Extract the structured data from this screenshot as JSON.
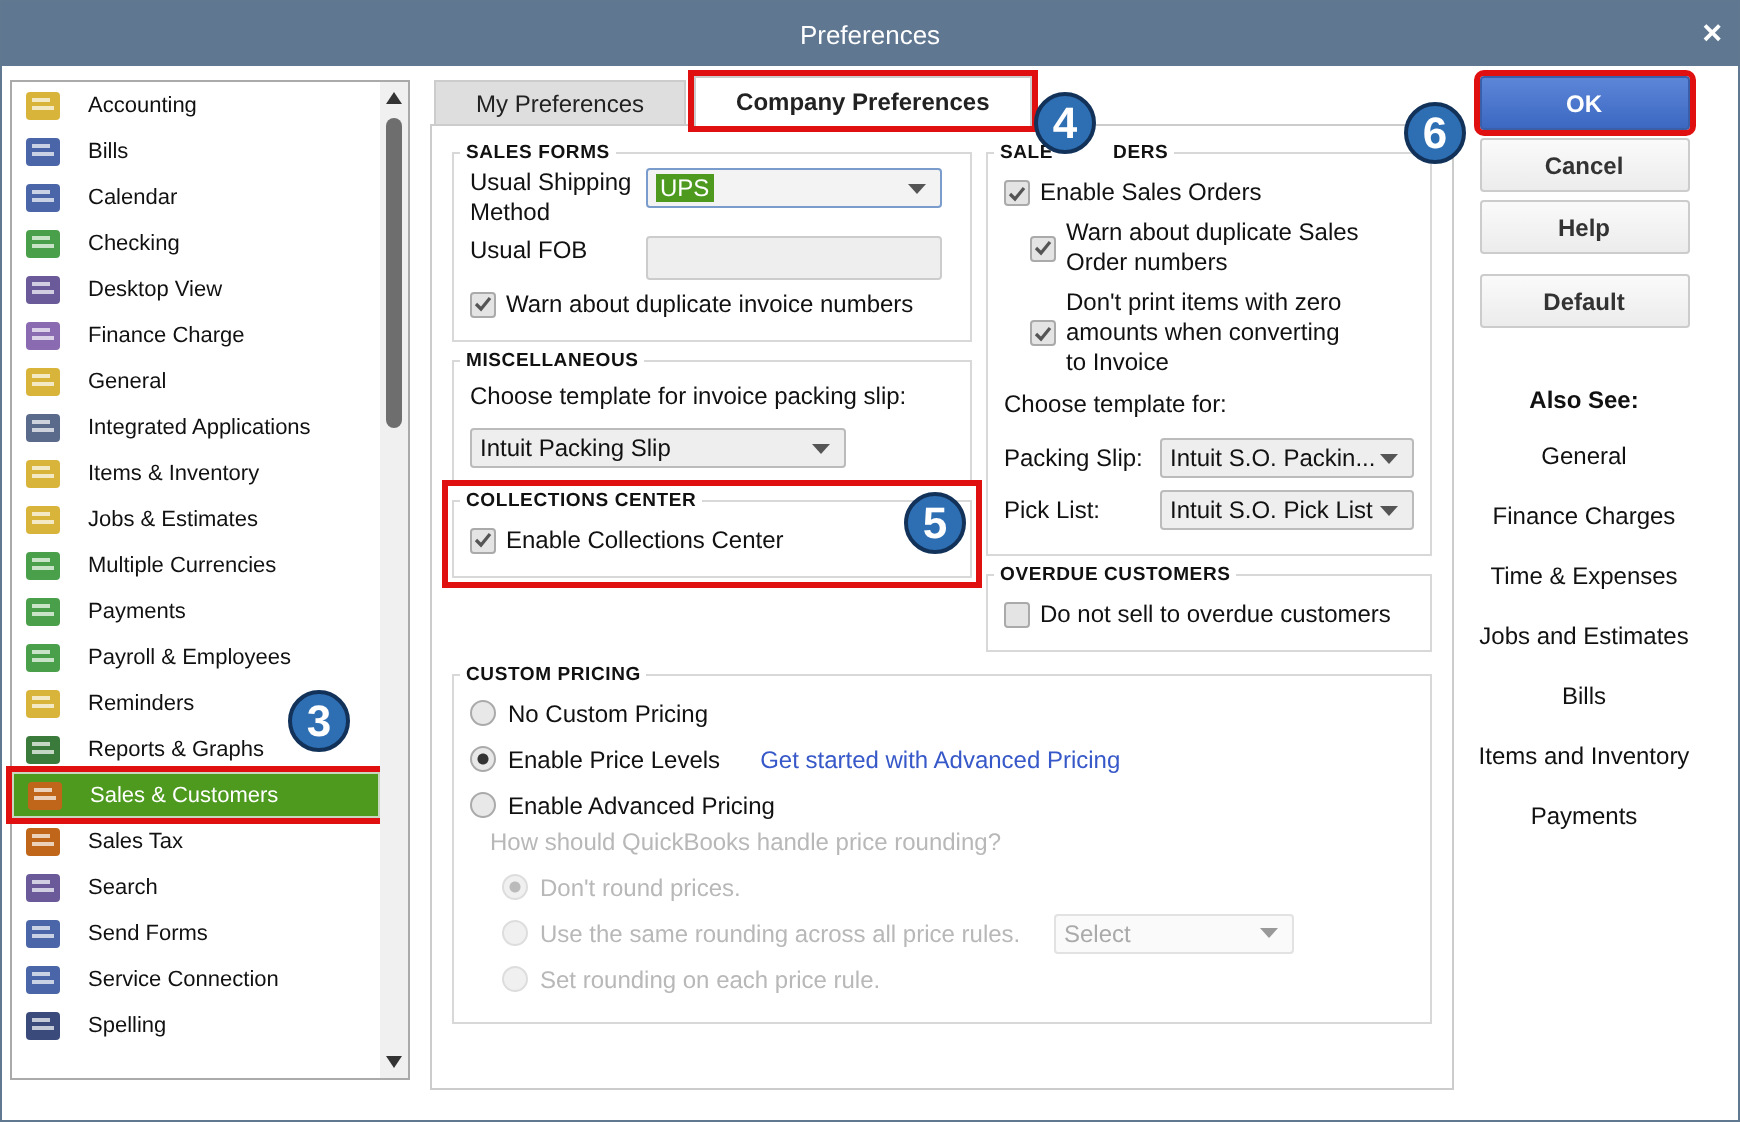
{
  "window": {
    "title": "Preferences",
    "close": "×"
  },
  "categories": [
    {
      "label": "Accounting",
      "selected": false,
      "highlighted": false
    },
    {
      "label": "Bills",
      "selected": false,
      "highlighted": false
    },
    {
      "label": "Calendar",
      "selected": false,
      "highlighted": false
    },
    {
      "label": "Checking",
      "selected": false,
      "highlighted": false
    },
    {
      "label": "Desktop View",
      "selected": false,
      "highlighted": false
    },
    {
      "label": "Finance Charge",
      "selected": false,
      "highlighted": false
    },
    {
      "label": "General",
      "selected": false,
      "highlighted": false
    },
    {
      "label": "Integrated Applications",
      "selected": false,
      "highlighted": false
    },
    {
      "label": "Items & Inventory",
      "selected": false,
      "highlighted": false
    },
    {
      "label": "Jobs & Estimates",
      "selected": false,
      "highlighted": false
    },
    {
      "label": "Multiple Currencies",
      "selected": false,
      "highlighted": false
    },
    {
      "label": "Payments",
      "selected": false,
      "highlighted": false
    },
    {
      "label": "Payroll & Employees",
      "selected": false,
      "highlighted": false
    },
    {
      "label": "Reminders",
      "selected": false,
      "highlighted": false
    },
    {
      "label": "Reports & Graphs",
      "selected": false,
      "highlighted": false
    },
    {
      "label": "Sales & Customers",
      "selected": true,
      "highlighted": true
    },
    {
      "label": "Sales Tax",
      "selected": false,
      "highlighted": false
    },
    {
      "label": "Search",
      "selected": false,
      "highlighted": false
    },
    {
      "label": "Send Forms",
      "selected": false,
      "highlighted": false
    },
    {
      "label": "Service Connection",
      "selected": false,
      "highlighted": false
    },
    {
      "label": "Spelling",
      "selected": false,
      "highlighted": false
    }
  ],
  "tabs": [
    {
      "label": "My Preferences",
      "selected": false,
      "highlighted": false
    },
    {
      "label": "Company Preferences",
      "selected": true,
      "highlighted": true
    }
  ],
  "sales_forms": {
    "title": "SALES FORMS",
    "shipping_label": "Usual Shipping Method",
    "shipping_value": "UPS",
    "fob_label": "Usual FOB",
    "warn": {
      "label": "Warn about duplicate invoice numbers",
      "checked": true
    }
  },
  "miscellaneous": {
    "title": "MISCELLANEOUS",
    "prompt": "Choose template for invoice packing slip:",
    "packing_slip": "Intuit Packing Slip"
  },
  "collections_center": {
    "title": "COLLECTIONS CENTER",
    "highlighted": true,
    "option": {
      "label": "Enable Collections Center",
      "checked": true
    }
  },
  "sales_orders": {
    "title_parts": [
      "SALE",
      "DERS"
    ],
    "options": [
      {
        "label": "Enable Sales Orders",
        "checked": true,
        "indent": false
      },
      {
        "label": "Warn about duplicate Sales Order numbers",
        "checked": true,
        "indent": true
      },
      {
        "label": "Don't print items with zero amounts when converting to Invoice",
        "checked": true,
        "indent": true
      }
    ],
    "template_prompt": "Choose template for:",
    "templates": [
      {
        "label": "Packing Slip:",
        "value": "Intuit S.O. Packin..."
      },
      {
        "label": "Pick List:",
        "value": "Intuit S.O. Pick List"
      }
    ]
  },
  "overdue_customers": {
    "title": "OVERDUE CUSTOMERS",
    "option": {
      "label": "Do not sell to overdue customers",
      "checked": false
    }
  },
  "custom_pricing": {
    "title": "CUSTOM PRICING",
    "options": [
      {
        "label": "No Custom Pricing",
        "selected": false
      },
      {
        "label": "Enable Price Levels",
        "selected": true
      },
      {
        "label": "Enable Advanced Pricing",
        "selected": false
      }
    ],
    "link": "Get started with Advanced Pricing",
    "rounding": {
      "question": "How should QuickBooks handle price rounding?",
      "disabled": true,
      "options": [
        {
          "label": "Don't round prices.",
          "selected": true
        },
        {
          "label": "Use the same rounding across all price rules.",
          "selected": false
        },
        {
          "label": "Set rounding on each price rule.",
          "selected": false
        }
      ],
      "select_placeholder": "Select"
    }
  },
  "buttons": [
    {
      "label": "OK",
      "kind": "primary",
      "highlighted": true
    },
    {
      "label": "Cancel",
      "kind": "normal",
      "highlighted": false
    },
    {
      "label": "Help",
      "kind": "normal",
      "highlighted": false
    },
    {
      "label": "Default",
      "kind": "normal",
      "highlighted": false
    }
  ],
  "also_see": {
    "title": "Also See:",
    "links": [
      "General",
      "Finance Charges",
      "Time & Expenses",
      "Jobs and Estimates",
      "Bills",
      "Items and Inventory",
      "Payments"
    ]
  },
  "callouts": [
    "3",
    "4",
    "5",
    "6"
  ]
}
